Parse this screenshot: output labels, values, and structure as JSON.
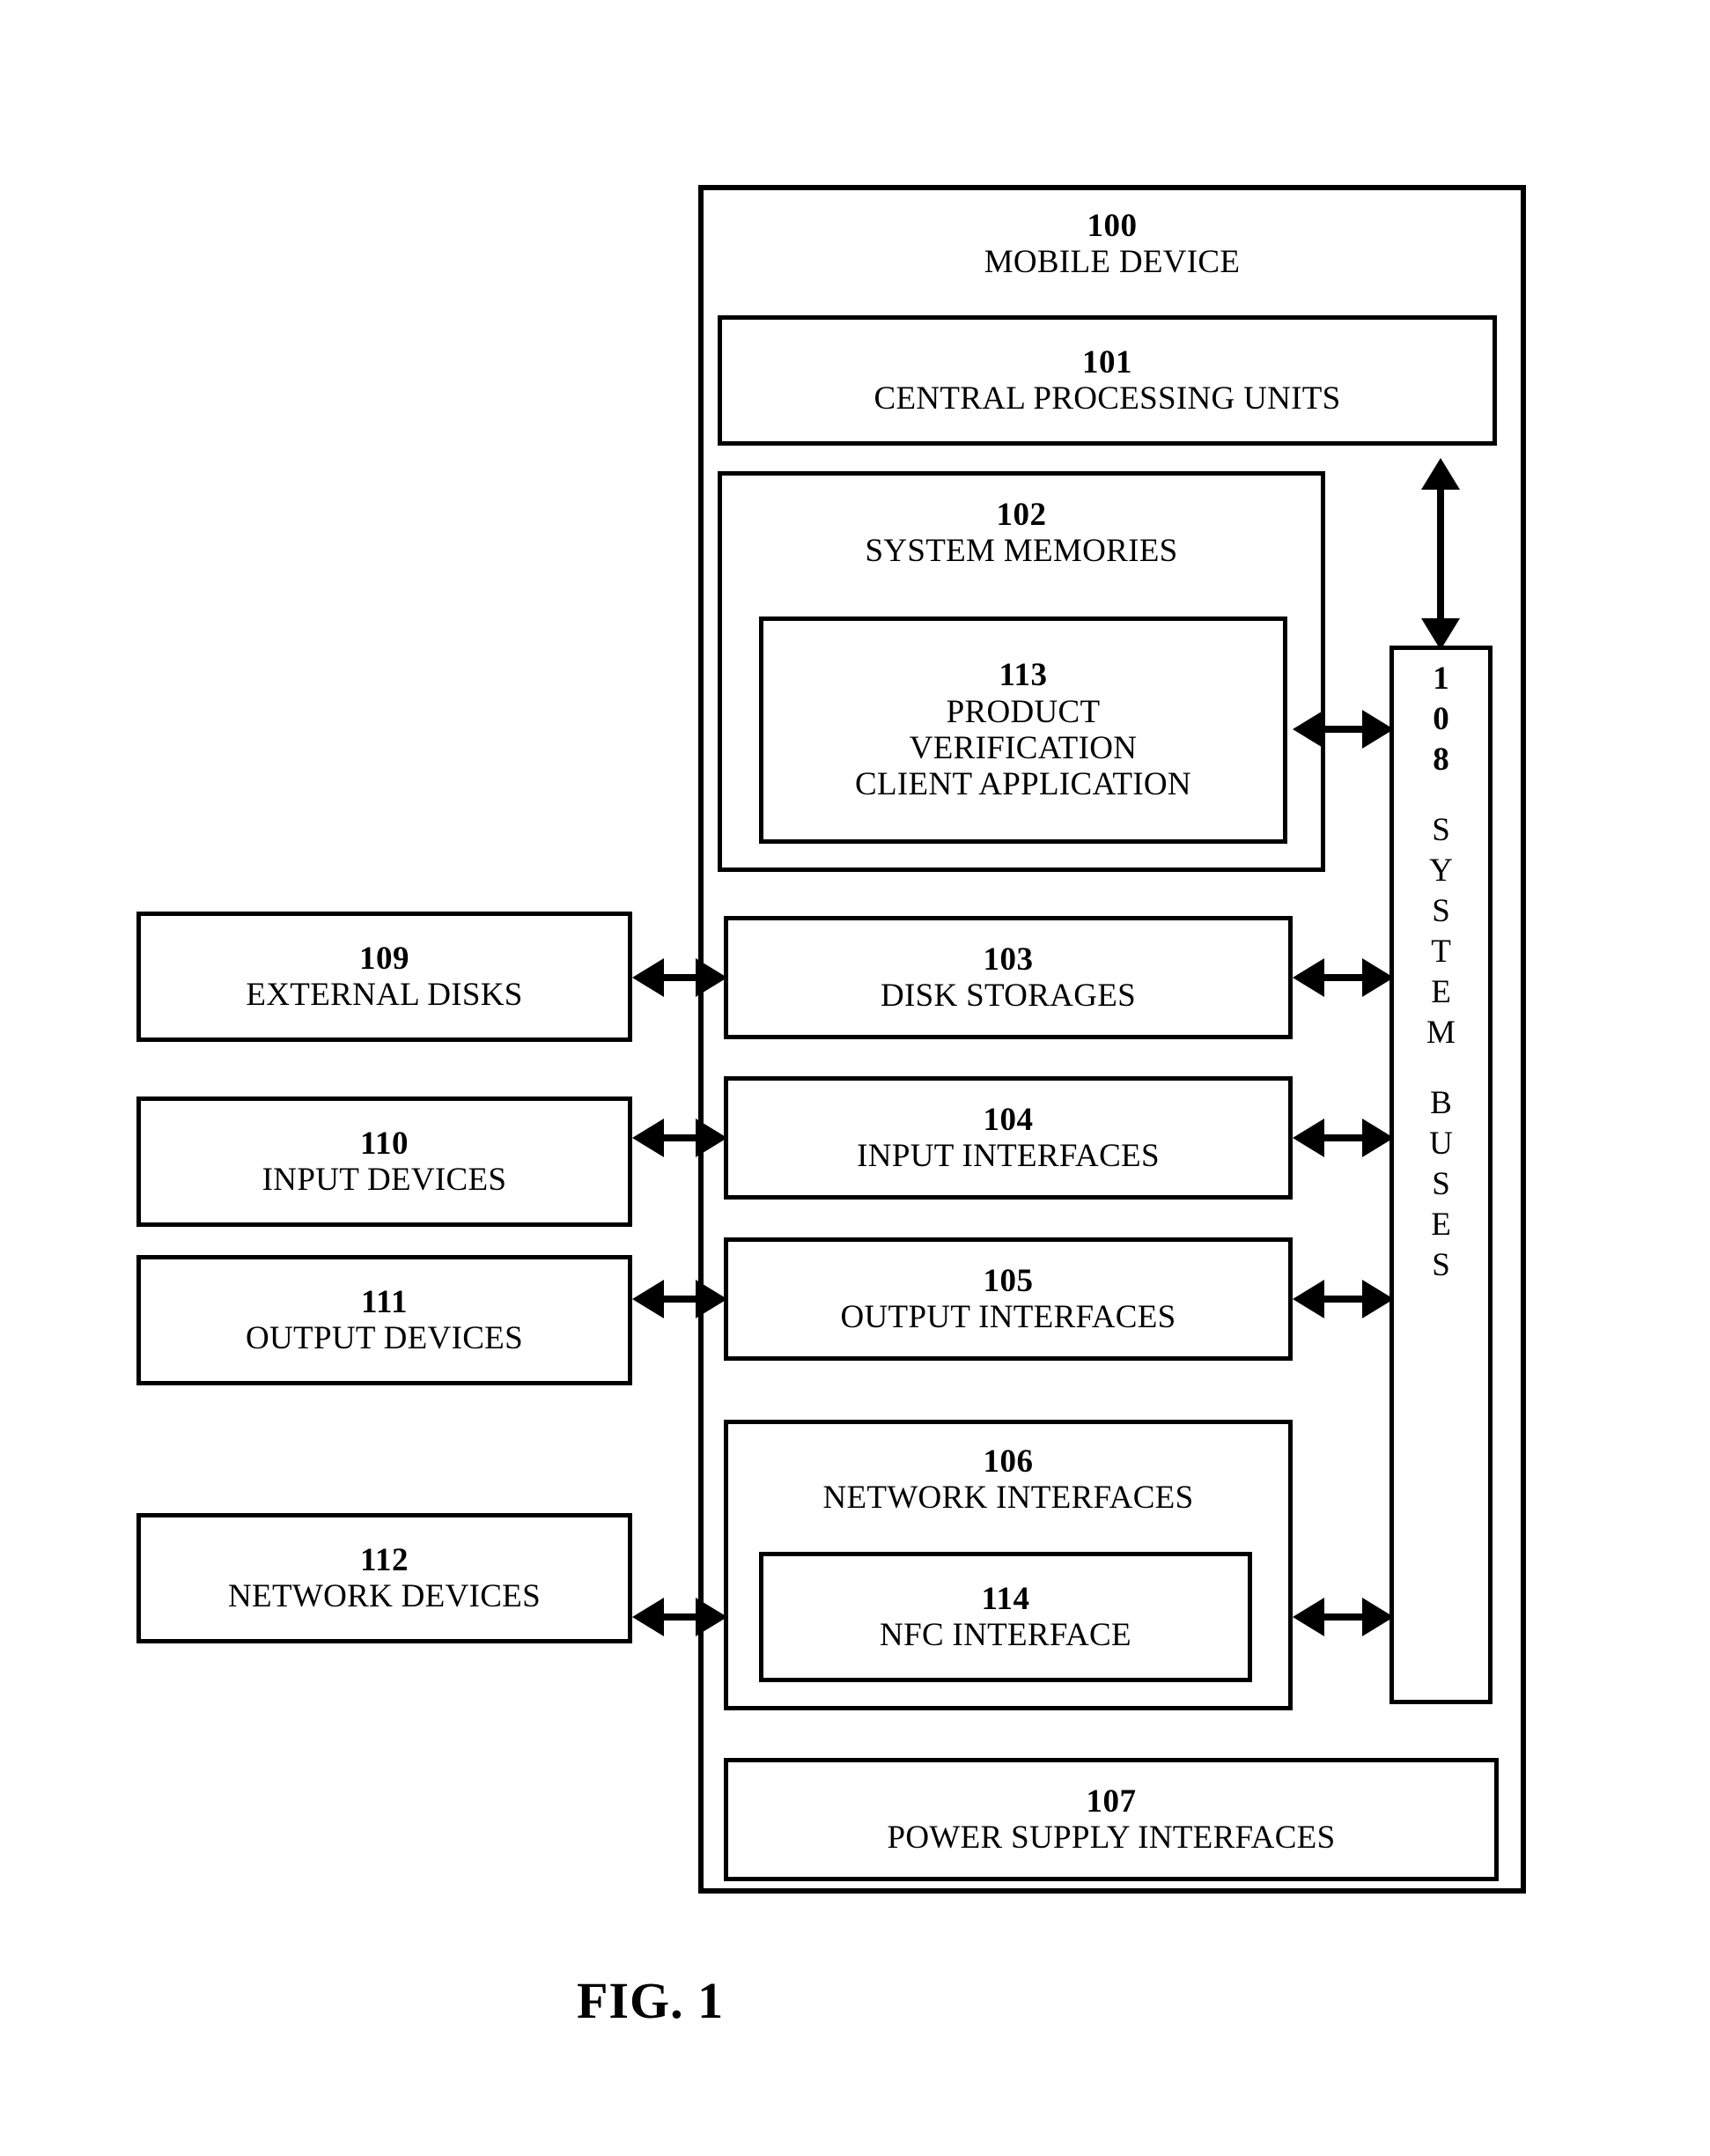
{
  "figure": {
    "caption": "FIG. 1"
  },
  "device": {
    "ref": "100",
    "label": "MOBILE DEVICE"
  },
  "blocks": {
    "cpu": {
      "ref": "101",
      "label": "CENTRAL PROCESSING UNITS"
    },
    "memories": {
      "ref": "102",
      "label": "SYSTEM MEMORIES"
    },
    "client_app": {
      "ref": "113",
      "label_line1": "PRODUCT",
      "label_line2": "VERIFICATION",
      "label_line3": "CLIENT APPLICATION"
    },
    "disk_storages": {
      "ref": "103",
      "label": "DISK STORAGES"
    },
    "input_ifaces": {
      "ref": "104",
      "label": "INPUT INTERFACES"
    },
    "output_ifaces": {
      "ref": "105",
      "label": "OUTPUT INTERFACES"
    },
    "network_ifaces": {
      "ref": "106",
      "label": "NETWORK INTERFACES"
    },
    "nfc_iface": {
      "ref": "114",
      "label": "NFC INTERFACE"
    },
    "power_ifaces": {
      "ref": "107",
      "label": "POWER SUPPLY INTERFACES"
    },
    "external_disks": {
      "ref": "109",
      "label": "EXTERNAL DISKS"
    },
    "input_devices": {
      "ref": "110",
      "label": "INPUT DEVICES"
    },
    "output_devices": {
      "ref": "111",
      "label": "OUTPUT DEVICES"
    },
    "network_devices": {
      "ref": "112",
      "label": "NETWORK DEVICES"
    }
  },
  "system_buses": {
    "ref_chars": [
      "1",
      "0",
      "8"
    ],
    "label_chars_line1": [
      "S",
      "Y",
      "S",
      "T",
      "E",
      "M"
    ],
    "label_chars_line2": [
      "B",
      "U",
      "S",
      "E",
      "S"
    ],
    "ref": "108",
    "label": "SYSTEM BUSES"
  },
  "colors": {
    "stroke": "#000000",
    "background": "#ffffff"
  }
}
